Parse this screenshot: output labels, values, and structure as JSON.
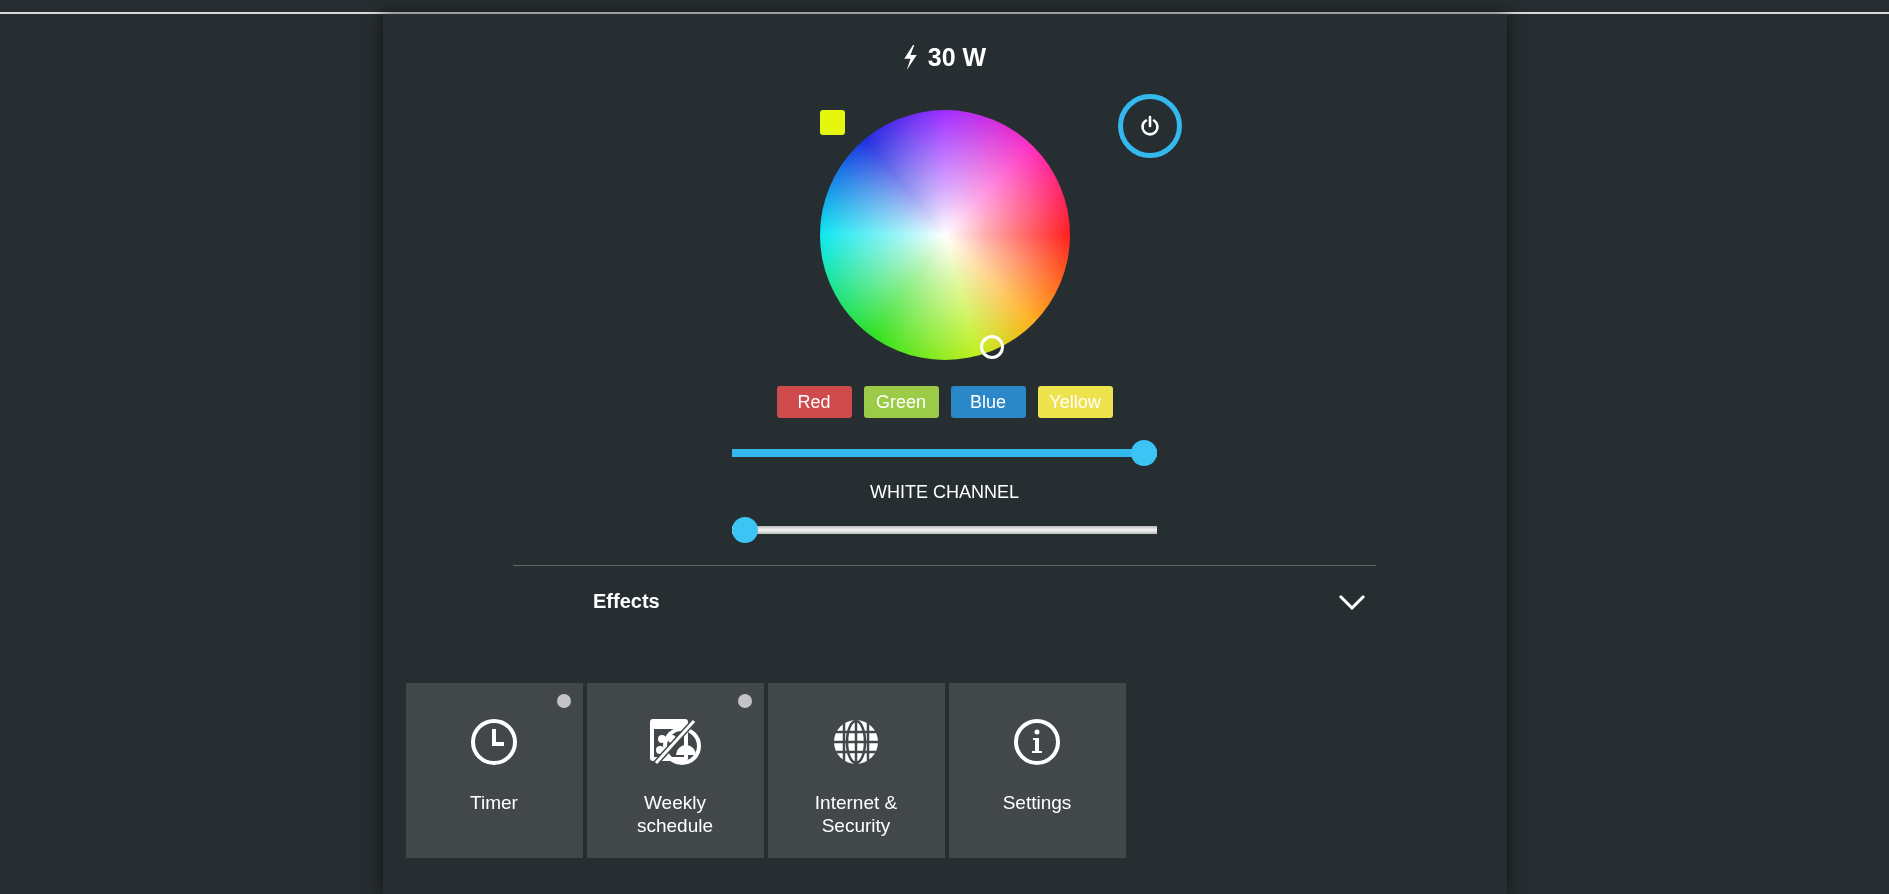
{
  "power_reading": "30 W",
  "power_on": true,
  "color_presets": [
    {
      "label": "Red",
      "color": "#cf4a4d"
    },
    {
      "label": "Green",
      "color": "#9ccc47"
    },
    {
      "label": "Blue",
      "color": "#2a88c8"
    },
    {
      "label": "Yellow",
      "color": "#eee34d"
    }
  ],
  "brightness_slider": {
    "level": 1
  },
  "white_channel": {
    "label": "WHITE CHANNEL",
    "level": 0
  },
  "effects": {
    "label": "Effects",
    "expanded": false
  },
  "tiles": [
    {
      "kind": "timer",
      "label": "Timer",
      "indicator": true
    },
    {
      "kind": "schedule",
      "label": "Weekly schedule",
      "indicator": true
    },
    {
      "kind": "internet",
      "label": "Internet & Security",
      "indicator": false
    },
    {
      "kind": "settings",
      "label": "Settings",
      "indicator": false
    }
  ]
}
